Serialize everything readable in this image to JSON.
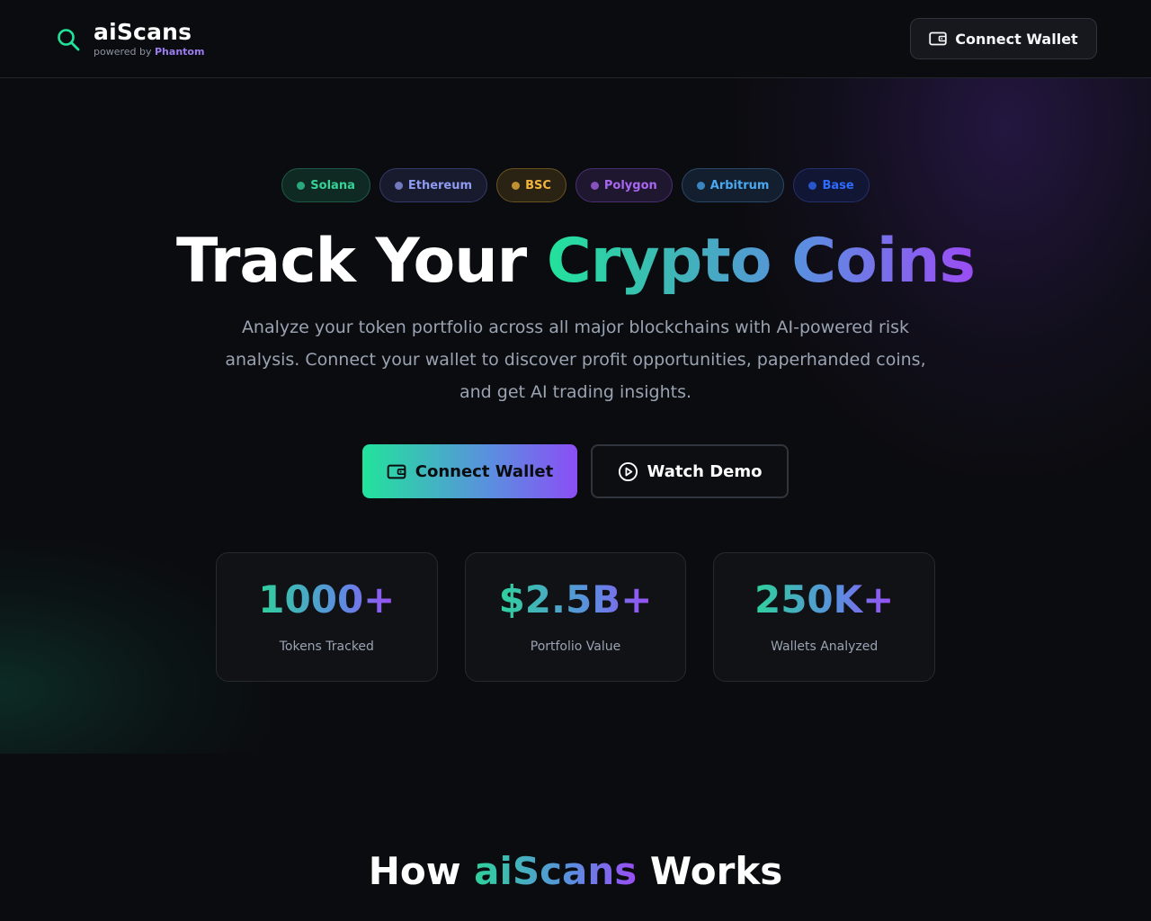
{
  "header": {
    "brand_name": "aiScans",
    "brand_sub_prefix": "powered by",
    "brand_sub_partner": "Phantom",
    "connect_label": "Connect Wallet"
  },
  "chains": [
    {
      "label": "Solana",
      "color": "#34d399",
      "bg": "#0f2a22",
      "border": "#1f5a45"
    },
    {
      "label": "Ethereum",
      "color": "#8f9bf0",
      "bg": "#181a2e",
      "border": "#35396a"
    },
    {
      "label": "BSC",
      "color": "#f3b43c",
      "bg": "#2a2212",
      "border": "#6a5120"
    },
    {
      "label": "Polygon",
      "color": "#a867f0",
      "bg": "#1f1630",
      "border": "#4a2f70"
    },
    {
      "label": "Arbitrum",
      "color": "#4aa8f0",
      "bg": "#131f2e",
      "border": "#2a4868"
    },
    {
      "label": "Base",
      "color": "#2f6bff",
      "bg": "#101634",
      "border": "#23306a"
    }
  ],
  "hero": {
    "title_plain": "Track Your ",
    "title_gradient": "Crypto Coins",
    "description": "Analyze your token portfolio across all major blockchains with AI-powered risk analysis. Connect your wallet to discover profit opportunities, paperhanded coins, and get AI trading insights.",
    "primary_cta": "Connect Wallet",
    "secondary_cta": "Watch Demo"
  },
  "stats": [
    {
      "value": "1000+",
      "label": "Tokens Tracked"
    },
    {
      "value": "$2.5B+",
      "label": "Portfolio Value"
    },
    {
      "value": "250K+",
      "label": "Wallets Analyzed"
    }
  ],
  "how": {
    "title_prefix": "How ",
    "title_gradient": "aiScans",
    "title_suffix": " Works"
  },
  "colors": {
    "accent_green": "#22e39b",
    "accent_purple": "#9b4cf5",
    "background": "#0b0c0f"
  },
  "icons": {
    "brand": "search-icon",
    "wallet": "wallet-icon",
    "play": "play-circle-icon"
  }
}
